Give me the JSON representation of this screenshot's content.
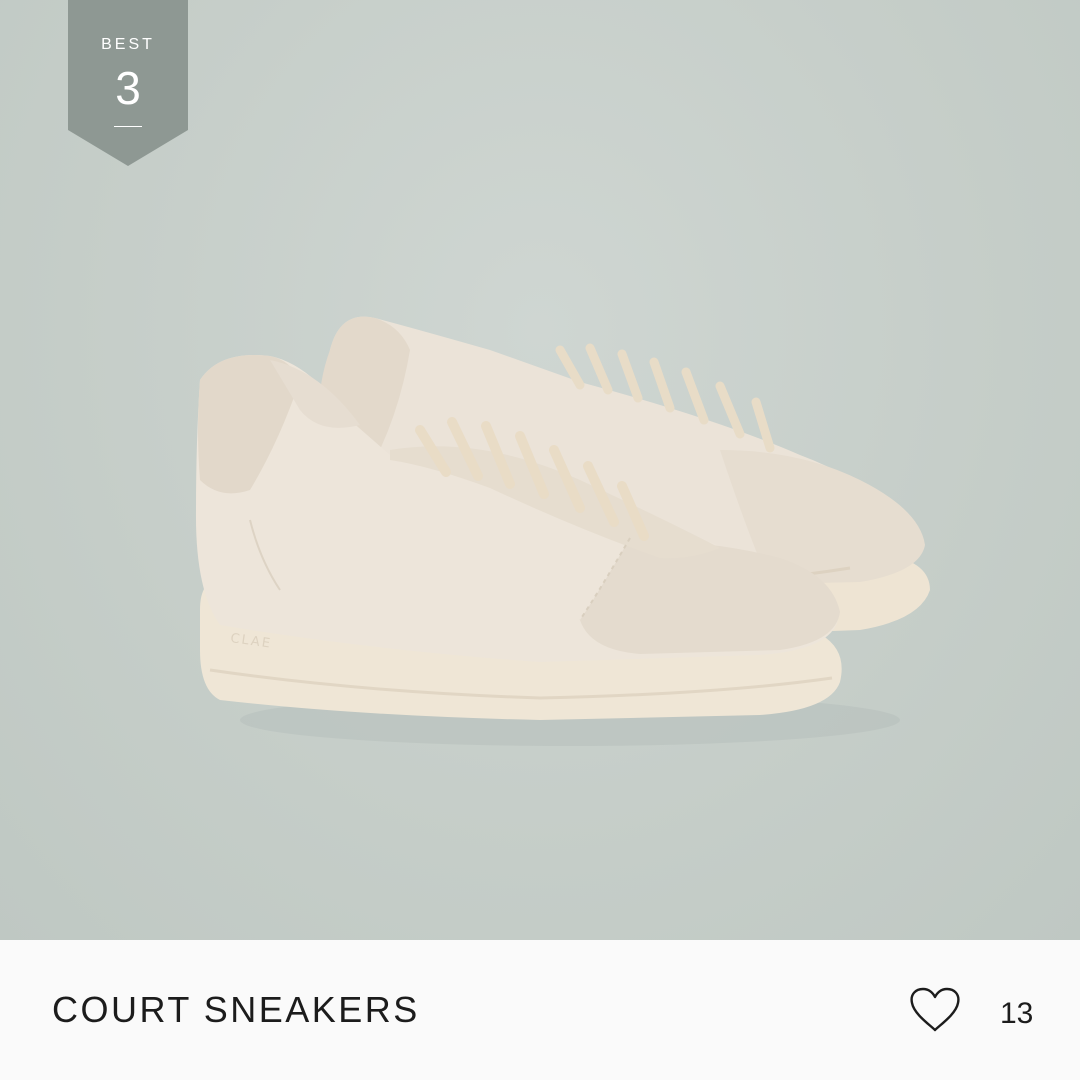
{
  "badge": {
    "label": "BEST",
    "rank": "3"
  },
  "product": {
    "name": "COURT SNEAKERS",
    "image_subject": "cream-sneakers-pair",
    "shoe_brand_mark": "CLAE"
  },
  "likes": {
    "icon": "heart-outline-icon",
    "count": "13"
  },
  "colors": {
    "background": "#c6cec9",
    "badge": "#8e9893",
    "info_bar": "#fafafa",
    "text": "#1c1c1c",
    "shoe_leather": "#ece4d9",
    "shoe_suede": "#e5dccf",
    "sole": "#efe6d6"
  }
}
